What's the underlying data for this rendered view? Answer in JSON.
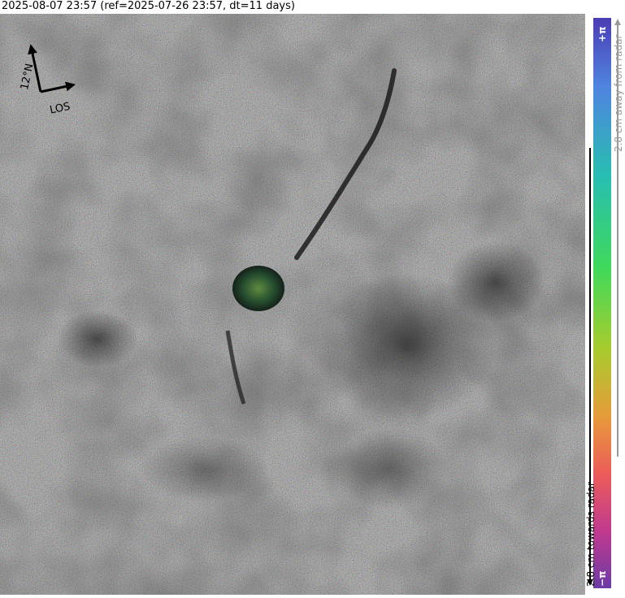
{
  "title": "2025-08-07 23:57 (ref=2025-07-26 23:57, dt=11 days)",
  "map": {
    "north_arrow_label": "12°N",
    "los_label": "LOS",
    "arrow_heading_deg": -12
  },
  "colorbar": {
    "top_label": "+π",
    "bottom_label": "−π",
    "away_label": "2.8 cm away from radar",
    "towards_label": "2.8 cm towards radar",
    "colors": [
      "#4b3db4",
      "#4f84e0",
      "#27bfb0",
      "#40d95a",
      "#a8cc2e",
      "#e79a3a",
      "#ec5c5a",
      "#c13a8e",
      "#6c3aa7"
    ]
  }
}
